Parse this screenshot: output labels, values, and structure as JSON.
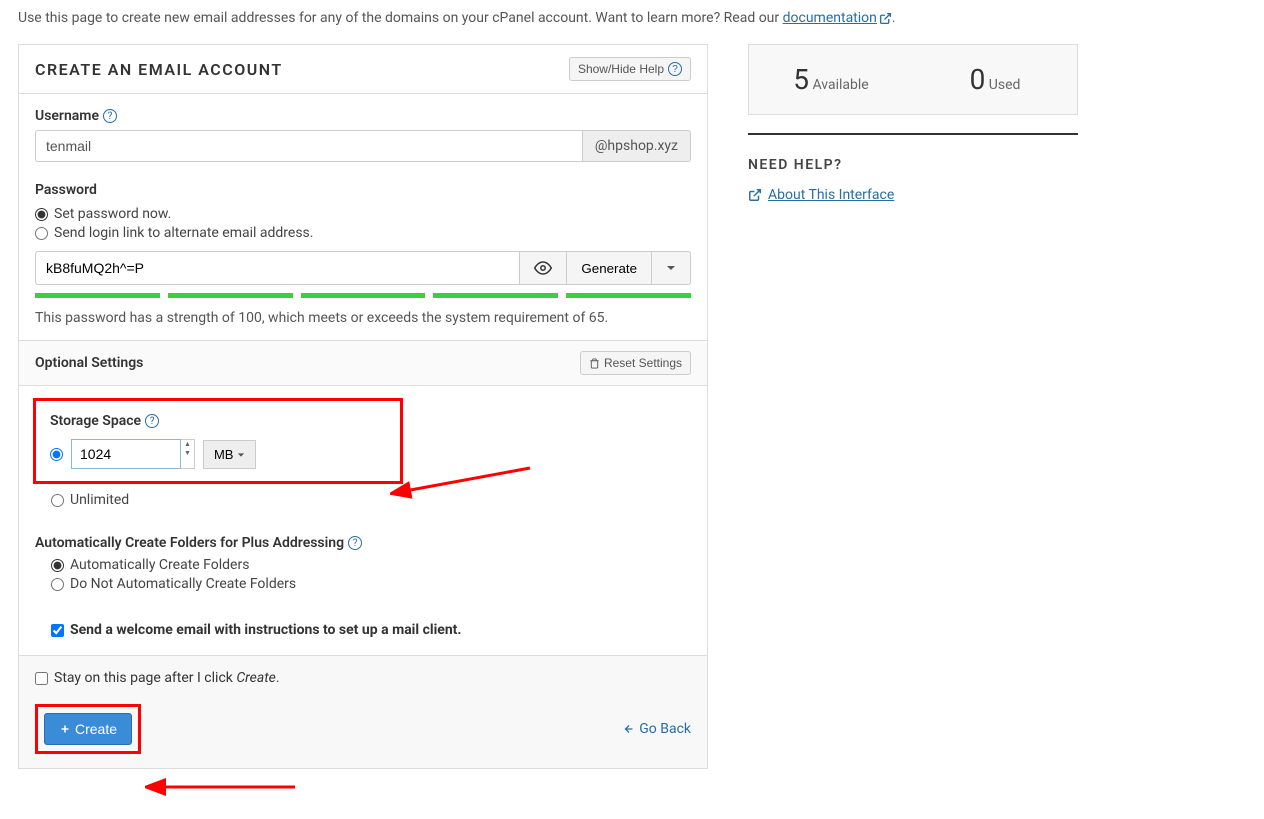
{
  "intro": {
    "text_before": "Use this page to create new email addresses for any of the domains on your cPanel account. Want to learn more? Read our ",
    "link": "documentation",
    "text_after": "."
  },
  "panel": {
    "title": "CREATE AN EMAIL ACCOUNT",
    "show_hide": "Show/Hide Help"
  },
  "username": {
    "label": "Username",
    "value": "tenmail",
    "domain": "@hpshop.xyz"
  },
  "password": {
    "label": "Password",
    "opt_now": "Set password now.",
    "opt_link": "Send login link to alternate email address.",
    "value": "kB8fuMQ2h^=P",
    "generate": "Generate",
    "strength_text": "This password has a strength of 100, which meets or exceeds the system requirement of 65."
  },
  "optional": {
    "title": "Optional Settings",
    "reset": "Reset Settings",
    "storage_label": "Storage Space",
    "storage_value": "1024",
    "storage_unit": "MB",
    "unlimited": "Unlimited",
    "folders_label": "Automatically Create Folders for Plus Addressing",
    "folders_yes": "Automatically Create Folders",
    "folders_no": "Do Not Automatically Create Folders",
    "welcome": "Send a welcome email with instructions to set up a mail client."
  },
  "footer": {
    "stay_before": "Stay on this page after I click ",
    "stay_italic": "Create",
    "stay_after": ".",
    "create": "Create",
    "goback": "Go Back"
  },
  "side": {
    "available_num": "5",
    "available_lbl": "Available",
    "used_num": "0",
    "used_lbl": "Used",
    "need_help": "NEED HELP?",
    "about": "About This Interface"
  }
}
